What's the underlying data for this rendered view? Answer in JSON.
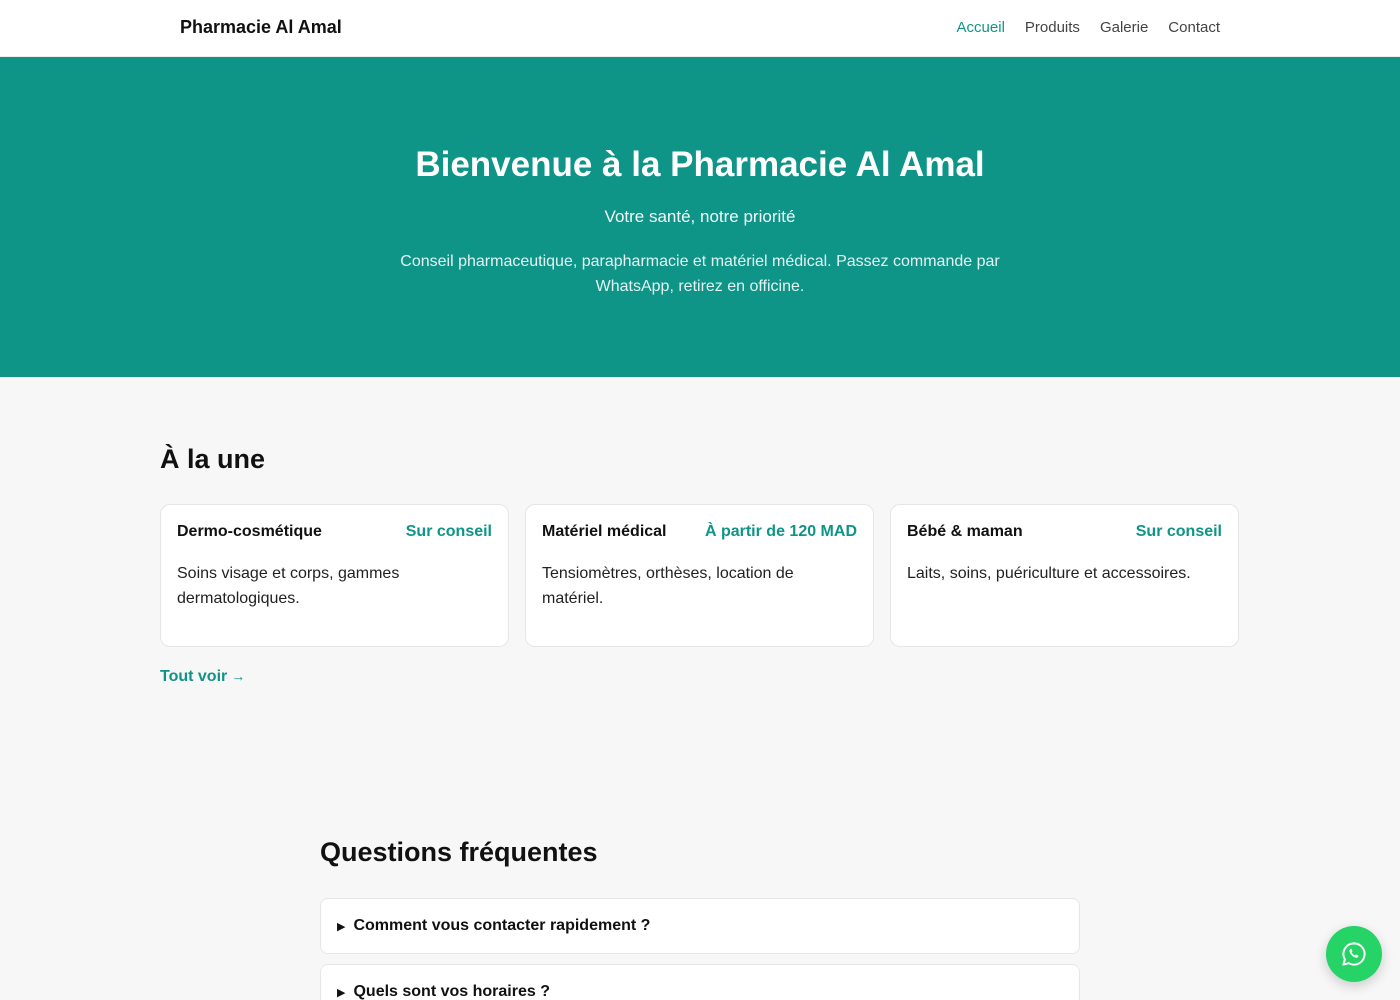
{
  "header": {
    "brand": "Pharmacie Al Amal",
    "nav": [
      {
        "label": "Accueil",
        "active": true
      },
      {
        "label": "Produits",
        "active": false
      },
      {
        "label": "Galerie",
        "active": false
      },
      {
        "label": "Contact",
        "active": false
      }
    ]
  },
  "hero": {
    "title": "Bienvenue à la Pharmacie Al Amal",
    "tagline": "Votre santé, notre priorité",
    "description": "Conseil pharmaceutique, parapharmacie et matériel médical. Passez commande par WhatsApp, retirez en officine."
  },
  "featured": {
    "heading": "À la une",
    "cards": [
      {
        "title": "Dermo-cosmétique",
        "price": "Sur conseil",
        "description": "Soins visage et corps, gammes dermatologiques."
      },
      {
        "title": "Matériel médical",
        "price": "À partir de 120 MAD",
        "description": "Tensiomètres, orthèses, location de matériel."
      },
      {
        "title": "Bébé & maman",
        "price": "Sur conseil",
        "description": "Laits, soins, puériculture et accessoires."
      }
    ],
    "see_all": "Tout voir",
    "see_all_arrow": "→"
  },
  "faq": {
    "heading": "Questions fréquentes",
    "items": [
      {
        "question": "Comment vous contacter rapidement ?"
      },
      {
        "question": "Quels sont vos horaires ?"
      }
    ]
  },
  "colors": {
    "accent": "#0f9488",
    "whatsapp": "#25d366",
    "page_bg": "#f7f7f7"
  },
  "icons": {
    "faq_toggle": "triangle-right-icon",
    "fab": "whatsapp-icon"
  }
}
